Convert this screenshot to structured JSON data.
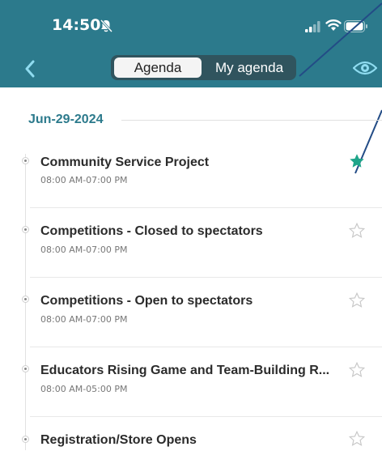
{
  "status_bar": {
    "time": "14:50"
  },
  "nav": {
    "tabs": [
      {
        "label": "Agenda",
        "selected": true
      },
      {
        "label": "My agenda",
        "selected": false
      }
    ]
  },
  "date_header": "Jun-29-2024",
  "events": [
    {
      "title": "Community Service Project",
      "time": "08:00 AM-07:00 PM",
      "starred": true
    },
    {
      "title": "Competitions - Closed to spectators",
      "time": "08:00 AM-07:00 PM",
      "starred": false
    },
    {
      "title": "Competitions - Open to spectators",
      "time": "08:00 AM-07:00 PM",
      "starred": false
    },
    {
      "title": "Educators Rising Game and Team-Building R...",
      "time": "08:00 AM-05:00 PM",
      "starred": false
    },
    {
      "title": "Registration/Store Opens",
      "time": "",
      "starred": false
    }
  ],
  "colors": {
    "header_bg": "#2c7a8c",
    "accent": "#2c7a8c",
    "star_active": "#1fa58a",
    "star_inactive": "#c8c8c8"
  }
}
